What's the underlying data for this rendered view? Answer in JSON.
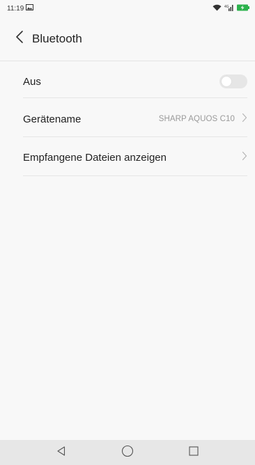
{
  "status_bar": {
    "time": "11:19",
    "notification_icon": "image-icon",
    "right_icons": [
      "wifi-icon",
      "signal-icon",
      "battery-charging-icon"
    ],
    "signal_text": "⁴ᴳ",
    "battery_color": "#2bb24c"
  },
  "header": {
    "title": "Bluetooth",
    "back_icon": "chevron-left-icon"
  },
  "settings": {
    "toggle_label": "Aus",
    "toggle_on": false,
    "device_name_label": "Gerätename",
    "device_name_value": "SHARP AQUOS C10",
    "received_files_label": "Empfangene Dateien anzeigen"
  },
  "navbar": {
    "buttons": [
      "back-triangle-icon",
      "home-circle-icon",
      "recents-square-icon"
    ]
  }
}
